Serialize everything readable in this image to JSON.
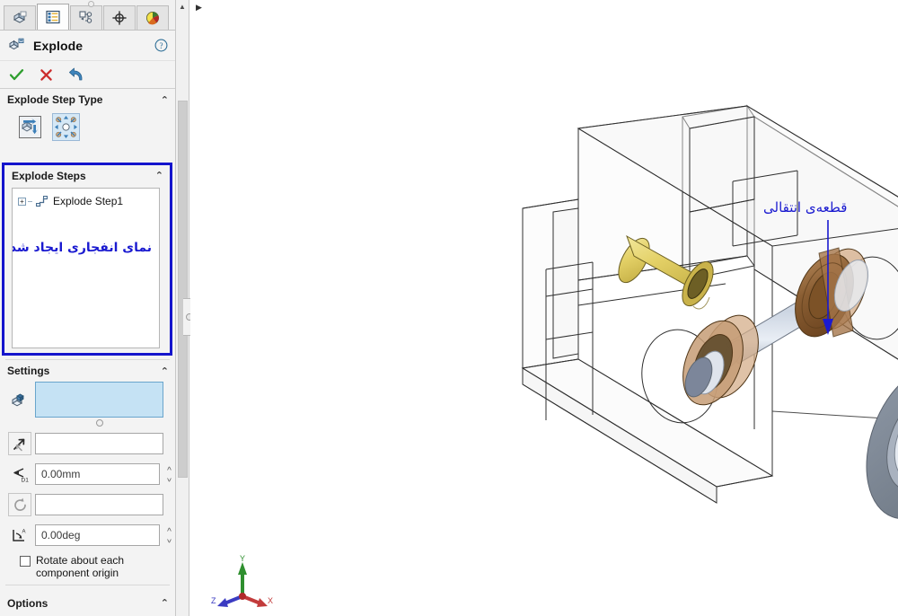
{
  "panel": {
    "tabs": [
      {
        "name": "feature-manager-tree",
        "label": "FeatureManager design tree",
        "selected": false
      },
      {
        "name": "property-manager",
        "label": "PropertyManager",
        "selected": true
      },
      {
        "name": "configuration-manager",
        "label": "ConfigurationManager",
        "selected": false
      },
      {
        "name": "dimxpert-manager",
        "label": "DimXpertManager",
        "selected": false
      },
      {
        "name": "display-manager",
        "label": "DisplayManager",
        "selected": false
      }
    ],
    "title": "Explode",
    "help_label": "?",
    "actions": {
      "ok_label": "OK",
      "cancel_label": "Cancel",
      "undo_label": "Undo"
    },
    "groups": {
      "explode_step_type": {
        "title": "Explode Step Type",
        "chevron": "⌃",
        "buttons": [
          {
            "name": "regular-step-translate-rotate",
            "label": "Regular step (translate and rotate)",
            "selected": false
          },
          {
            "name": "radial-step",
            "label": "Radial step",
            "selected": true
          }
        ]
      },
      "explode_steps": {
        "title": "Explode Steps",
        "chevron": "⌃",
        "items": [
          {
            "label": "Explode Step1",
            "expander": "+"
          }
        ],
        "annotation_fa": "نمای انفجاری ایجاد شده"
      },
      "settings": {
        "title": "Settings",
        "chevron": "⌃",
        "fields": [
          {
            "name": "components-to-explode",
            "icon": "components-icon",
            "value": "",
            "placeholder": "",
            "selected": true
          },
          {
            "name": "explode-direction",
            "icon": "direction-arrow-icon",
            "value": "",
            "placeholder": ""
          },
          {
            "name": "explode-distance",
            "icon": "distance-d1-icon",
            "value": "0.00mm",
            "placeholder": "0.00mm",
            "spinner": true
          },
          {
            "name": "rotation-axis",
            "icon": "rotate-axis-icon",
            "value": "",
            "placeholder": ""
          },
          {
            "name": "rotation-angle",
            "icon": "angle-icon",
            "value": "0.00deg",
            "placeholder": "0.00deg",
            "spinner": true
          }
        ],
        "checkbox": {
          "name": "rotate-about-each-component-origin",
          "label": "Rotate about each\ncomponent origin",
          "line1": "Rotate about each",
          "line2": "component origin",
          "checked": false
        }
      },
      "options": {
        "title": "Options",
        "chevron": "⌃"
      }
    }
  },
  "viewport": {
    "annotation_fa": "قطعه‌ی انتقالی",
    "annotation_color": "#1a1ad0",
    "triad": {
      "x_label": "X",
      "y_label": "Y",
      "z_label": "Z",
      "x_color": "#d63b3b",
      "y_color": "#2f9e2f",
      "z_color": "#3b3bd6"
    },
    "background": "#ffffff"
  },
  "colors": {
    "panel_bg": "#f3f3f3",
    "highlight_border": "#1414cc",
    "selected_field": "#c5e2f4",
    "accent_text": "#1a1ad0",
    "ok_green": "#2e9e2e",
    "cancel_red": "#cc2d2d",
    "undo_blue": "#2f7bb5"
  }
}
